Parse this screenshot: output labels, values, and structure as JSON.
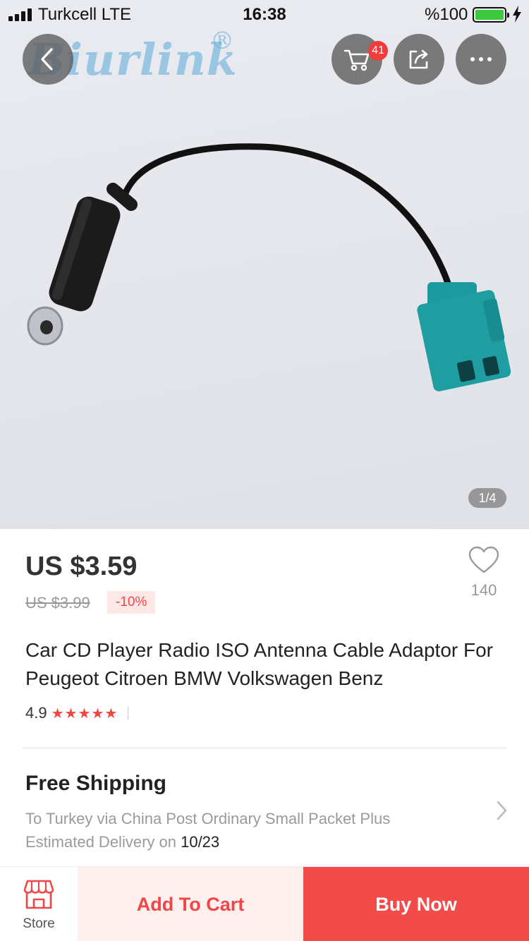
{
  "status_bar": {
    "carrier": "Turkcell   LTE",
    "time": "16:38",
    "battery": "%100"
  },
  "header": {
    "watermark": "Biurlink",
    "watermark_mark": "®",
    "cart_badge": "41",
    "icons": [
      "back-icon",
      "cart-icon",
      "share-icon",
      "more-icon"
    ]
  },
  "gallery": {
    "counter": "1/4"
  },
  "product": {
    "price": "US $3.59",
    "original_price": "US $3.99",
    "discount": "-10%",
    "wishlist_count": "140",
    "title": "Car CD Player Radio ISO Antenna Cable Adaptor For Peugeot Citroen BMW Volkswagen Benz",
    "rating": "4.9",
    "stars": "★★★★★"
  },
  "shipping": {
    "title": "Free Shipping",
    "line1": "To Turkey via China Post Ordinary Small Packet Plus",
    "line2_prefix": "Estimated Delivery on ",
    "date": "10/23"
  },
  "bottom_bar": {
    "store_label": "Store",
    "add_to_cart": "Add To Cart",
    "buy_now": "Buy Now"
  },
  "colors": {
    "accent": "#f24545",
    "buy_now_bg": "#f34a4a",
    "add_cart_bg": "#fef0ef",
    "connector_teal": "#1f9ea2"
  }
}
